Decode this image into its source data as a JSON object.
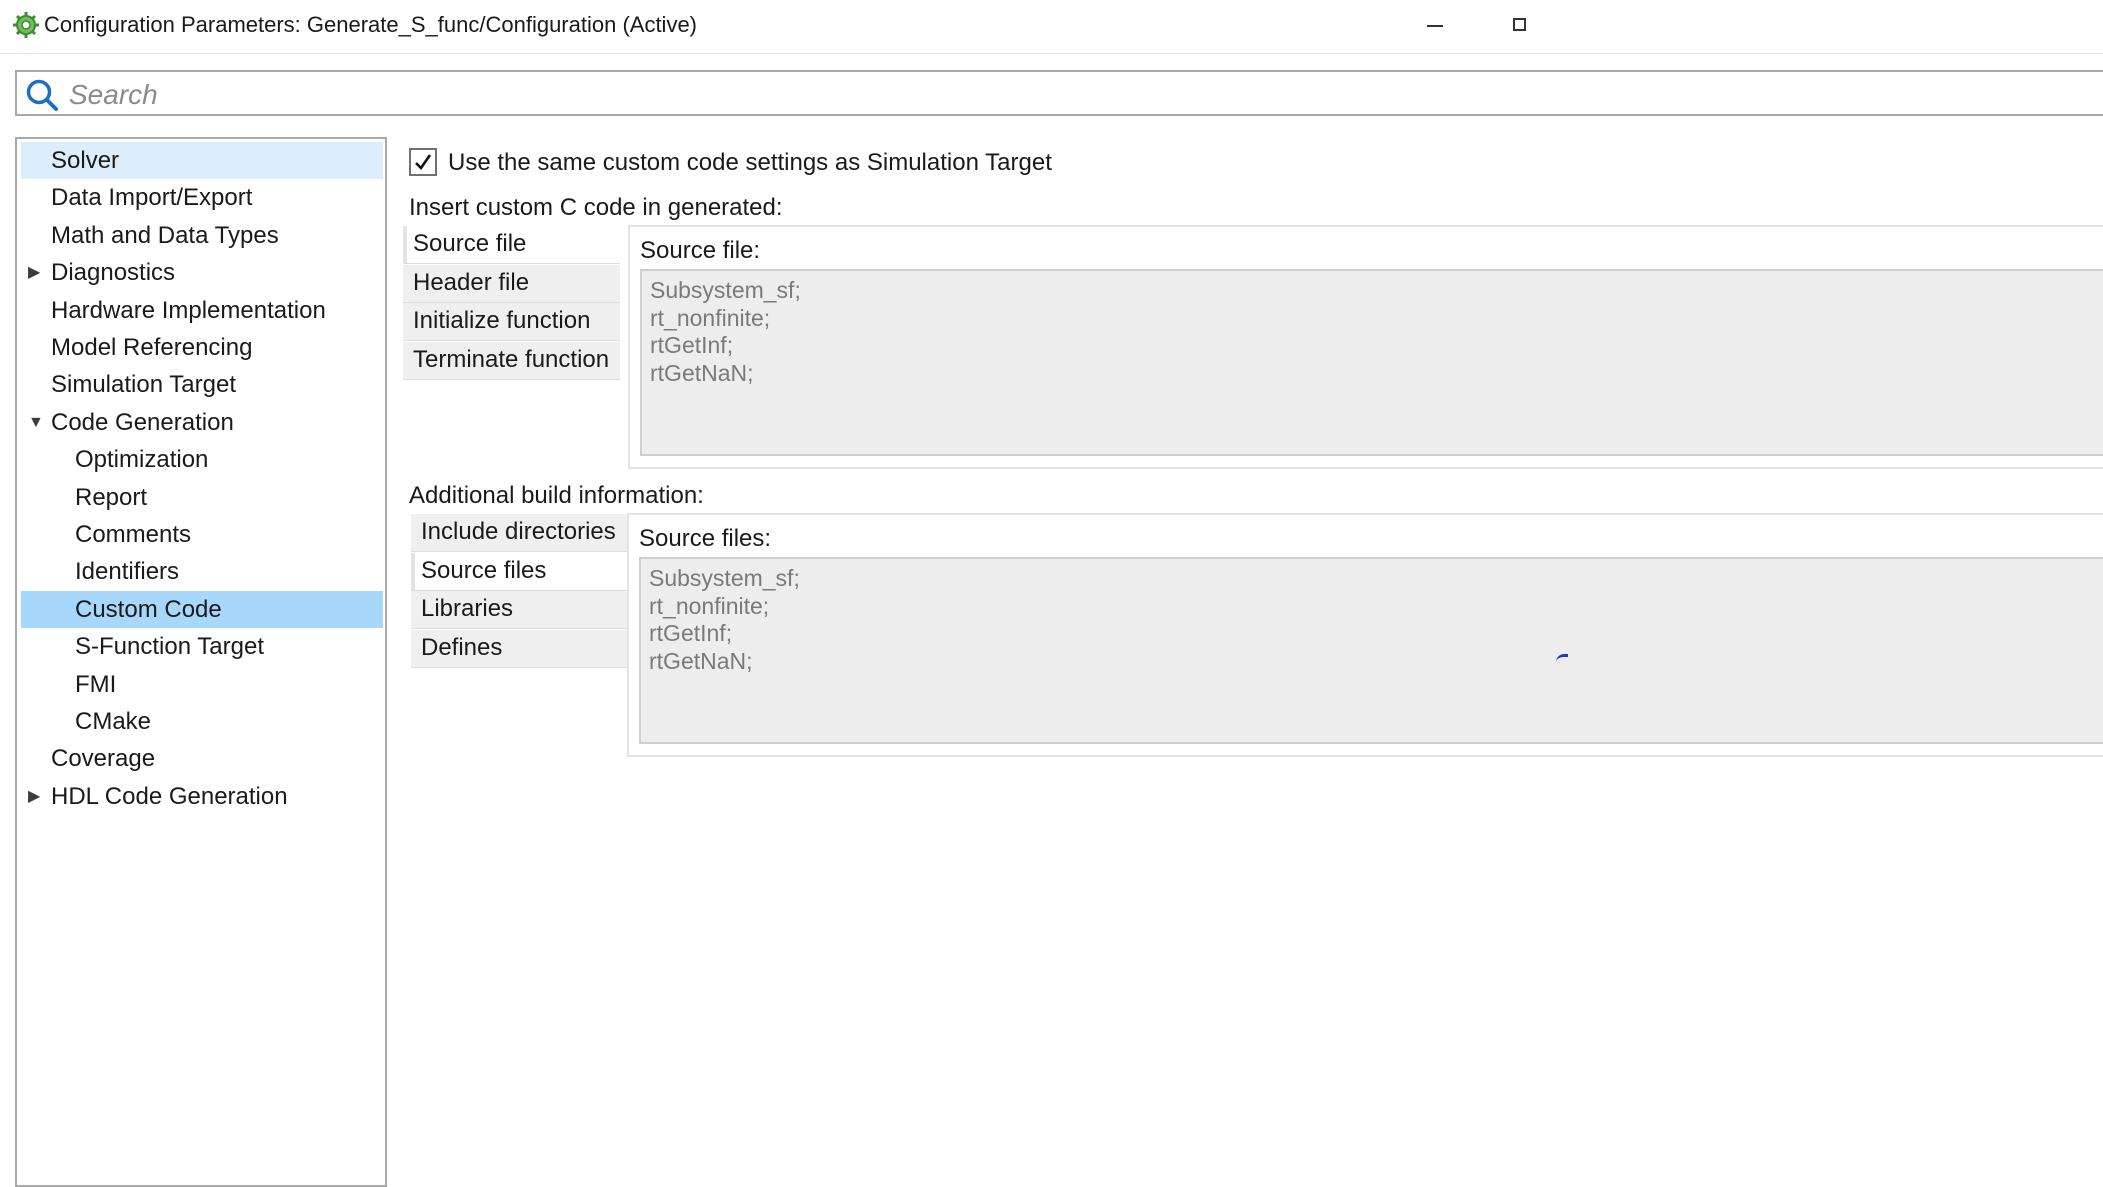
{
  "window": {
    "title": "Configuration Parameters: Generate_S_func/Configuration (Active)",
    "app_icon": "gear-icon",
    "controls": {
      "minimize_icon": "minimize-icon",
      "maximize_icon": "maximize-icon"
    }
  },
  "search": {
    "placeholder": "Search",
    "icon": "search-icon"
  },
  "tree": {
    "items": [
      {
        "label": "Solver",
        "state": "hover"
      },
      {
        "label": "Data Import/Export"
      },
      {
        "label": "Math and Data Types"
      },
      {
        "label": "Diagnostics",
        "expander": "collapsed"
      },
      {
        "label": "Hardware Implementation"
      },
      {
        "label": "Model Referencing"
      },
      {
        "label": "Simulation Target"
      },
      {
        "label": "Code Generation",
        "expander": "expanded"
      },
      {
        "label": "Optimization"
      },
      {
        "label": "Report"
      },
      {
        "label": "Comments"
      },
      {
        "label": "Identifiers"
      },
      {
        "label": "Custom Code",
        "state": "selected"
      },
      {
        "label": "S-Function Target"
      },
      {
        "label": "FMI"
      },
      {
        "label": "CMake"
      },
      {
        "label": "Coverage"
      },
      {
        "label": "HDL Code Generation",
        "expander": "collapsed"
      }
    ]
  },
  "custom_code": {
    "same_settings_checkbox": {
      "checked": true,
      "label": "Use the same custom code settings as Simulation Target"
    },
    "insert_section": {
      "label": "Insert custom C code in generated:",
      "tabs": [
        "Source file",
        "Header file",
        "Initialize function",
        "Terminate function"
      ],
      "active_tab": "Source file",
      "panel_title": "Source file:",
      "content": [
        "Subsystem_sf;",
        "rt_nonfinite;",
        "rtGetInf;",
        "rtGetNaN;"
      ]
    },
    "build_section": {
      "label": "Additional build information:",
      "tabs": [
        "Include directories",
        "Source files",
        "Libraries",
        "Defines"
      ],
      "active_tab": "Source files",
      "panel_title": "Source files:",
      "content": [
        "Subsystem_sf;",
        "rt_nonfinite;",
        "rtGetInf;",
        "rtGetNaN;"
      ]
    }
  },
  "colors": {
    "selected_row": "#a7d8fb",
    "hover_row": "#dceefb",
    "border": "#a9a9a9",
    "readonly_text": "#7a7a7a",
    "readonly_bg": "#ededed"
  }
}
